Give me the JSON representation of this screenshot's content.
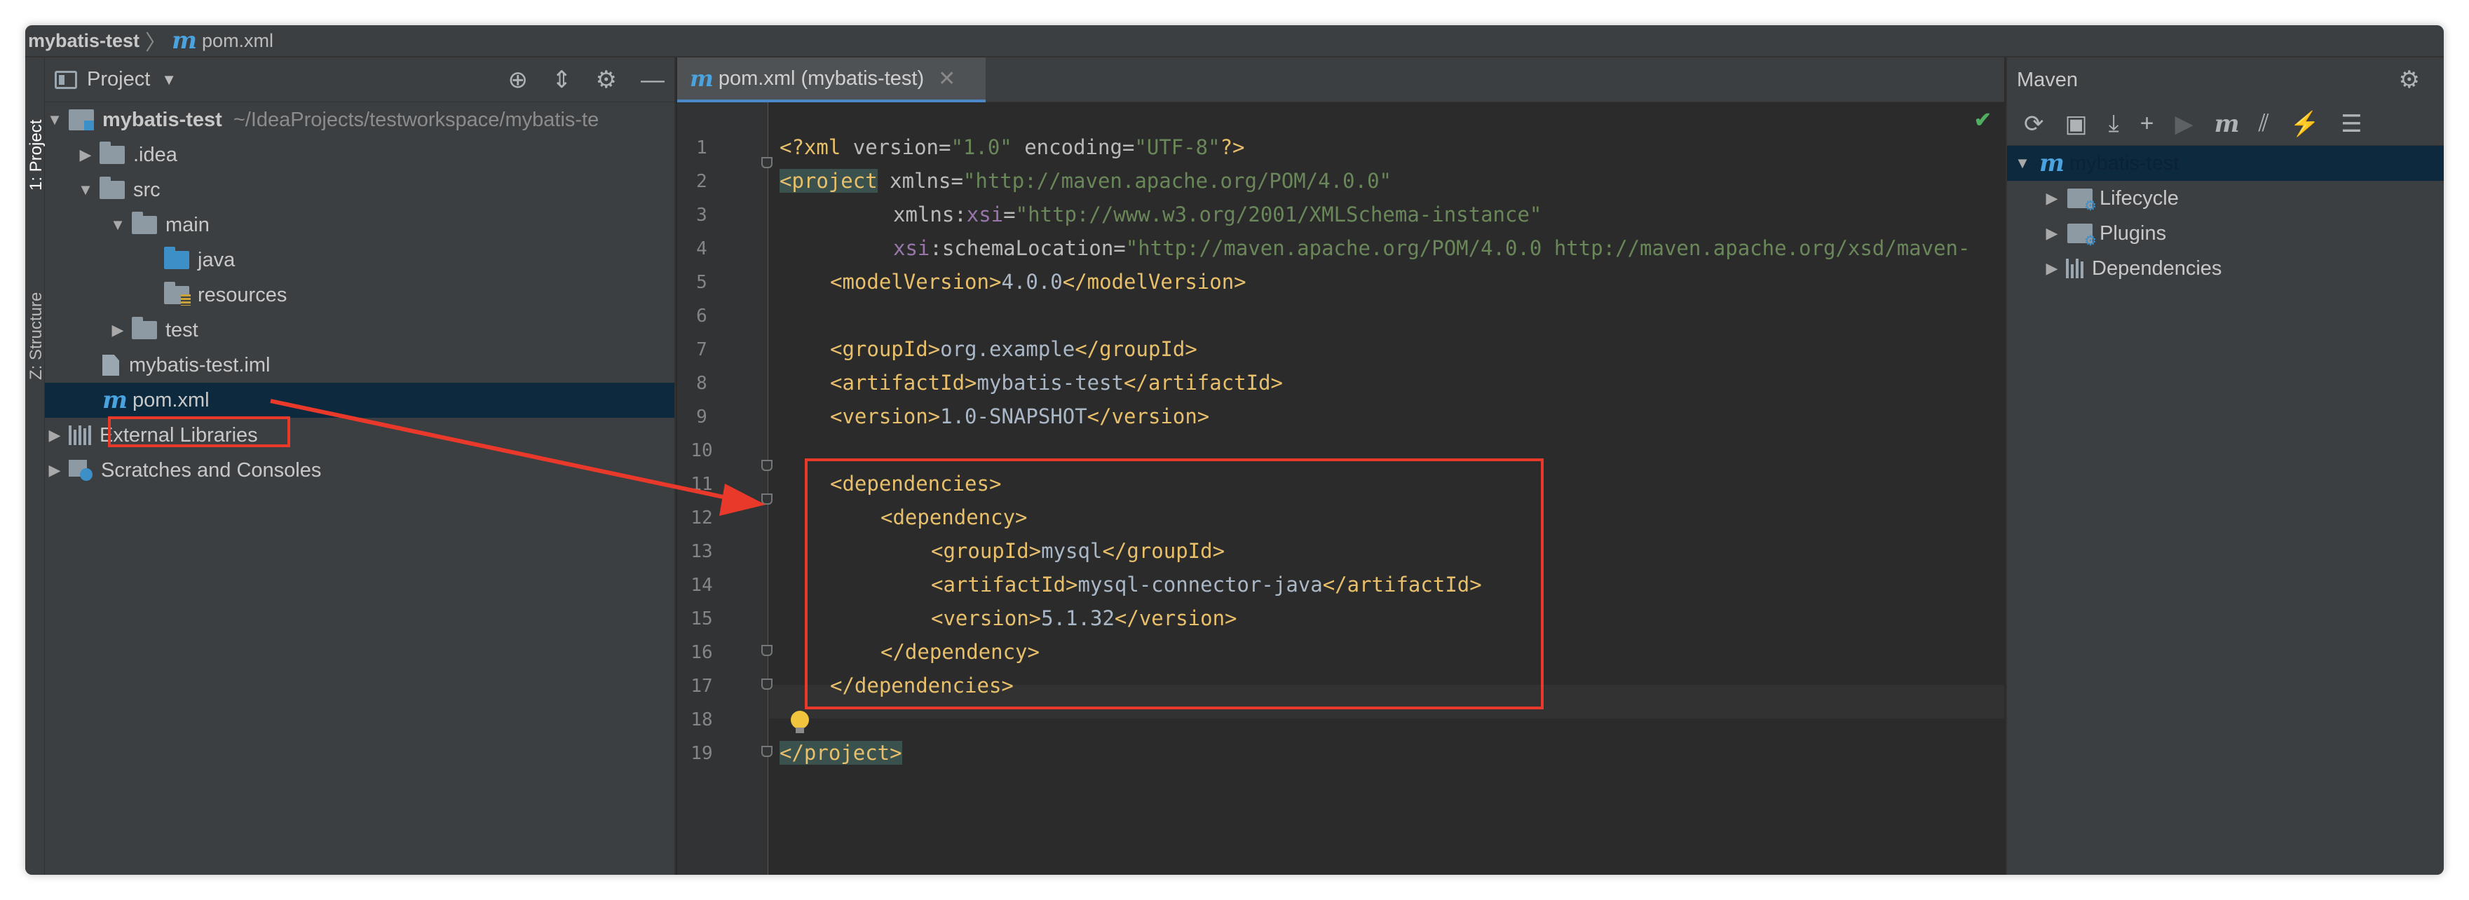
{
  "breadcrumb": {
    "project": "mybatis-test",
    "file": "pom.xml"
  },
  "left_strip": {
    "tab_project": "1: Project",
    "tab_structure": "Z: Structure"
  },
  "project_panel": {
    "title": "Project",
    "tree": [
      {
        "label": "mybatis-test",
        "path": "~/IdeaProjects/testworkspace/mybatis-te",
        "icon": "module-icon",
        "expanded": true
      },
      {
        "label": ".idea",
        "icon": "folder-icon",
        "expanded": false
      },
      {
        "label": "src",
        "icon": "folder-icon",
        "expanded": true
      },
      {
        "label": "main",
        "icon": "folder-icon",
        "expanded": true
      },
      {
        "label": "java",
        "icon": "source-folder-icon"
      },
      {
        "label": "resources",
        "icon": "resources-folder-icon"
      },
      {
        "label": "test",
        "icon": "folder-icon",
        "expanded": false
      },
      {
        "label": "mybatis-test.iml",
        "icon": "iml-file-icon"
      },
      {
        "label": "pom.xml",
        "icon": "maven-file-icon",
        "selected": true
      },
      {
        "label": "External Libraries",
        "icon": "library-icon",
        "expanded": false
      },
      {
        "label": "Scratches and Consoles",
        "icon": "scratches-icon",
        "expanded": false
      }
    ]
  },
  "editor": {
    "tab_label": "pom.xml (mybatis-test)",
    "line_numbers": [
      "1",
      "2",
      "3",
      "4",
      "5",
      "6",
      "7",
      "8",
      "9",
      "10",
      "11",
      "12",
      "13",
      "14",
      "15",
      "16",
      "17",
      "18",
      "19"
    ],
    "lines": {
      "l1_pi_open": "<?xml ",
      "l1_attr1": "version=",
      "l1_val1": "\"1.0\"",
      "l1_attr2": " encoding=",
      "l1_val2": "\"UTF-8\"",
      "l1_pi_close": "?>",
      "l2_tag": "<project",
      "l2_attr": " xmlns=",
      "l2_val": "\"http://maven.apache.org/POM/4.0.0\"",
      "l3_attr": "xmlns:",
      "l3_ns": "xsi",
      "l3_eq": "=",
      "l3_val": "\"http://www.w3.org/2001/XMLSchema-instance\"",
      "l4_ns": "xsi",
      "l4_attr": ":schemaLocation=",
      "l4_val": "\"http://maven.apache.org/POM/4.0.0 http://maven.apache.org/xsd/maven-",
      "l5_open": "<modelVersion>",
      "l5_text": "4.0.0",
      "l5_close": "</modelVersion>",
      "l7_open": "<groupId>",
      "l7_text": "org.example",
      "l7_close": "</groupId>",
      "l8_open": "<artifactId>",
      "l8_text": "mybatis-test",
      "l8_close": "</artifactId>",
      "l9_open": "<version>",
      "l9_text": "1.0-SNAPSHOT",
      "l9_close": "</version>",
      "l11_tag": "<dependencies>",
      "l12_tag": "<dependency>",
      "l13_open": "<groupId>",
      "l13_text": "mysql",
      "l13_close": "</groupId>",
      "l14_open": "<artifactId>",
      "l14_text": "mysql-connector-java",
      "l14_close": "</artifactId>",
      "l15_open": "<version>",
      "l15_text": "5.1.32",
      "l15_close": "</version>",
      "l16_tag": "</dependency>",
      "l17_tag": "</dependencies>",
      "l19_tag": "</project>"
    }
  },
  "maven_panel": {
    "title": "Maven",
    "tree": [
      {
        "label": "mybatis-test",
        "selected": true
      },
      {
        "label": "Lifecycle"
      },
      {
        "label": "Plugins"
      },
      {
        "label": "Dependencies"
      }
    ]
  },
  "colors": {
    "annotation": "#e8392b",
    "tag": "#e8bf6a",
    "string": "#6a8759",
    "selection": "#0d293e"
  }
}
